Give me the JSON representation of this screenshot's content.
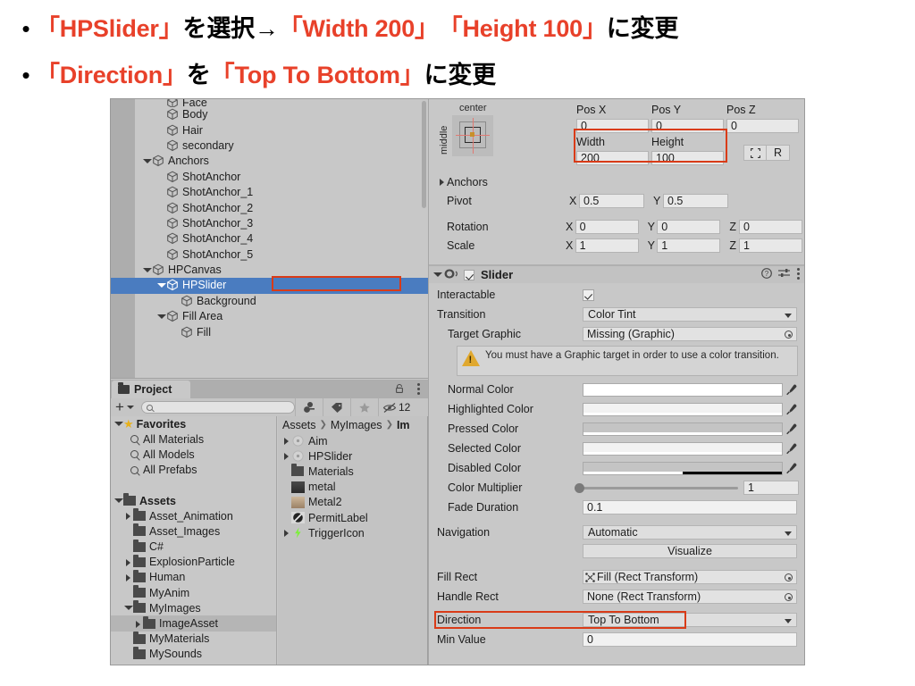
{
  "slide": {
    "bullets": [
      {
        "marker": "•",
        "parts": [
          {
            "t": "「HPSlider」",
            "hl": true
          },
          {
            "t": "を選択→",
            "hl": false
          },
          {
            "t": "「Width 200」",
            "hl": true
          },
          {
            "t": "　",
            "hl": false
          },
          {
            "t": "「Height 100」",
            "hl": true
          },
          {
            "t": "に変更",
            "hl": false
          }
        ]
      },
      {
        "marker": "•",
        "parts": [
          {
            "t": "「Direction」",
            "hl": true
          },
          {
            "t": "を",
            "hl": false
          },
          {
            "t": "「Top To Bottom」",
            "hl": true
          },
          {
            "t": "に変更",
            "hl": false
          }
        ]
      }
    ]
  },
  "colors": {
    "accent_red": "#E8412A",
    "highlight_box": "#D93B18",
    "selection_blue": "#4a7cc0",
    "panel_gray": "#c8c8c8",
    "warning_yellow": "#E0A82E",
    "trigger_green": "#7CF03A"
  },
  "hierarchy": {
    "rows": [
      {
        "label": "Face",
        "indent": 2,
        "toggle": "none",
        "clipped": true
      },
      {
        "label": "Body",
        "indent": 2,
        "toggle": "none"
      },
      {
        "label": "Hair",
        "indent": 2,
        "toggle": "none"
      },
      {
        "label": "secondary",
        "indent": 2,
        "toggle": "none"
      },
      {
        "label": "Anchors",
        "indent": 1,
        "toggle": "down"
      },
      {
        "label": "ShotAnchor",
        "indent": 2,
        "toggle": "none"
      },
      {
        "label": "ShotAnchor_1",
        "indent": 2,
        "toggle": "none"
      },
      {
        "label": "ShotAnchor_2",
        "indent": 2,
        "toggle": "none"
      },
      {
        "label": "ShotAnchor_3",
        "indent": 2,
        "toggle": "none"
      },
      {
        "label": "ShotAnchor_4",
        "indent": 2,
        "toggle": "none"
      },
      {
        "label": "ShotAnchor_5",
        "indent": 2,
        "toggle": "none"
      },
      {
        "label": "HPCanvas",
        "indent": 1,
        "toggle": "down"
      },
      {
        "label": "HPSlider",
        "indent": 2,
        "toggle": "down",
        "selected": true,
        "outlined": true
      },
      {
        "label": "Background",
        "indent": 3,
        "toggle": "none"
      },
      {
        "label": "Fill Area",
        "indent": 2,
        "toggle": "down"
      },
      {
        "label": "Fill",
        "indent": 3,
        "toggle": "none"
      }
    ]
  },
  "project": {
    "tab_label": "Project",
    "search_placeholder": "",
    "search_value": "",
    "hidden_count": "12",
    "breadcrumb": [
      "Assets",
      "MyImages",
      "Im"
    ],
    "favorites": {
      "label": "Favorites",
      "items": [
        "All Materials",
        "All Models",
        "All Prefabs"
      ]
    },
    "assets": {
      "label": "Assets",
      "items": [
        {
          "label": "Asset_Animation",
          "expandable": true
        },
        {
          "label": "Asset_Images",
          "expandable": false
        },
        {
          "label": "C#",
          "expandable": false
        },
        {
          "label": "ExplosionParticle",
          "expandable": true
        },
        {
          "label": "Human",
          "expandable": true
        },
        {
          "label": "MyAnim",
          "expandable": false
        },
        {
          "label": "MyImages",
          "expandable": true,
          "expanded": true
        },
        {
          "label": "ImageAsset",
          "expandable": true,
          "indent": 2,
          "highlighted": true
        },
        {
          "label": "MyMaterials",
          "expandable": false
        },
        {
          "label": "MySounds",
          "expandable": false
        }
      ]
    },
    "contents": [
      {
        "label": "Aim",
        "icon": "prefab-icon",
        "expandable": true
      },
      {
        "label": "HPSlider",
        "icon": "prefab-icon",
        "expandable": true
      },
      {
        "label": "Materials",
        "icon": "folder-icon",
        "expandable": false
      },
      {
        "label": "metal",
        "icon": "material-dark-icon",
        "expandable": false
      },
      {
        "label": "Metal2",
        "icon": "material-tan-icon",
        "expandable": false
      },
      {
        "label": "PermitLabel",
        "icon": "no-entry-icon",
        "expandable": false
      },
      {
        "label": "TriggerIcon",
        "icon": "lightning-icon",
        "expandable": true
      }
    ]
  },
  "inspector": {
    "rect_transform": {
      "anchor_preset_top": "center",
      "anchor_preset_side": "middle",
      "pos_headers": [
        "Pos X",
        "Pos Y",
        "Pos Z"
      ],
      "pos_values": [
        "0",
        "0",
        "0"
      ],
      "size_headers": [
        "Width",
        "Height"
      ],
      "size_values": [
        "200",
        "100"
      ],
      "blueprint_button": "blueprint-mode-icon",
      "raw_button": "R",
      "anchors_label": "Anchors",
      "pivot_label": "Pivot",
      "pivot": {
        "x_label": "X",
        "x": "0.5",
        "y_label": "Y",
        "y": "0.5"
      },
      "rotation_label": "Rotation",
      "rotation": {
        "x": "0",
        "y": "0",
        "z": "0"
      },
      "scale_label": "Scale",
      "scale": {
        "x": "1",
        "y": "1",
        "z": "1"
      },
      "axis_labels": [
        "X",
        "Y",
        "Z"
      ]
    },
    "slider": {
      "component_title": "Slider",
      "enabled": true,
      "interactable_label": "Interactable",
      "interactable_checked": true,
      "transition_label": "Transition",
      "transition_value": "Color Tint",
      "target_graphic_label": "Target Graphic",
      "target_graphic_value": "Missing (Graphic)",
      "warning_text": "You must have a Graphic target in order to use a color transition.",
      "color_rows": [
        {
          "label": "Normal Color",
          "swatch": "#ffffff",
          "alpha_pct": 100
        },
        {
          "label": "Highlighted Color",
          "swatch": "#f2f2f2",
          "alpha_pct": 100
        },
        {
          "label": "Pressed Color",
          "swatch": "#c4c4c4",
          "alpha_pct": 100
        },
        {
          "label": "Selected Color",
          "swatch": "#f2f2f2",
          "alpha_pct": 100
        },
        {
          "label": "Disabled Color",
          "swatch": "#c4c4c4",
          "alpha_pct": 50
        }
      ],
      "color_multiplier_label": "Color Multiplier",
      "color_multiplier_value": "1",
      "color_multiplier_pos_pct": 0,
      "fade_duration_label": "Fade Duration",
      "fade_duration_value": "0.1",
      "navigation_label": "Navigation",
      "navigation_value": "Automatic",
      "visualize_label": "Visualize",
      "fill_rect_label": "Fill Rect",
      "fill_rect_value": "Fill (Rect Transform)",
      "handle_rect_label": "Handle Rect",
      "handle_rect_value": "None (Rect Transform)",
      "direction_label": "Direction",
      "direction_value": "Top To Bottom",
      "min_value_label": "Min Value",
      "min_value_value": "0",
      "help_icon": "help-icon",
      "preset_icon": "preset-icon",
      "menu_icon": "kebab-menu-icon"
    }
  }
}
